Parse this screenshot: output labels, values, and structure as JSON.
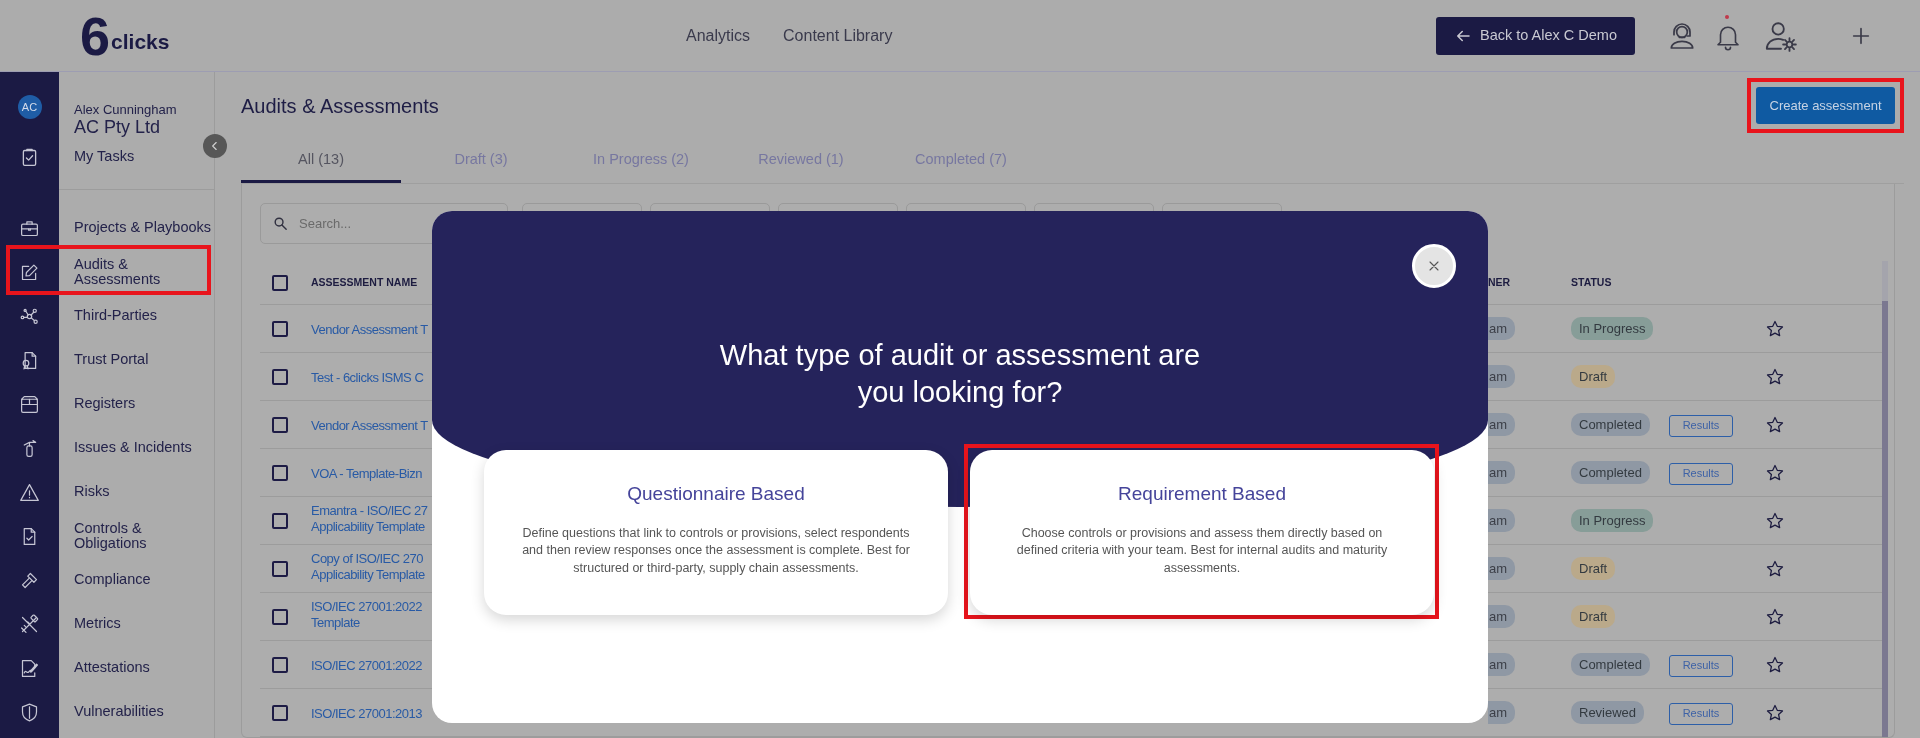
{
  "topbar": {
    "logo_mark": "6",
    "logo_text": "clicks",
    "nav": [
      "Analytics",
      "Content Library"
    ],
    "back_button": "Back to Alex C Demo",
    "notification_dot": true
  },
  "user": {
    "initials": "AC",
    "name": "Alex Cunningham",
    "company": "AC Pty Ltd"
  },
  "sidebar": {
    "my_tasks": "My Tasks",
    "items": [
      {
        "label": "Projects & Playbooks",
        "kind": "briefcase",
        "highlighted": false
      },
      {
        "label": "Audits &\nAssessments",
        "kind": "edit",
        "highlighted": true
      },
      {
        "label": "Third-Parties",
        "kind": "network",
        "highlighted": false
      },
      {
        "label": "Trust Portal",
        "kind": "certificate",
        "highlighted": false
      },
      {
        "label": "Registers",
        "kind": "box",
        "highlighted": false
      },
      {
        "label": "Issues & Incidents",
        "kind": "extinguisher",
        "highlighted": false
      },
      {
        "label": "Risks",
        "kind": "warning",
        "highlighted": false
      },
      {
        "label": "Controls &\nObligations",
        "kind": "doccheck",
        "highlighted": false
      },
      {
        "label": "Compliance",
        "kind": "hammer",
        "highlighted": false
      },
      {
        "label": "Metrics",
        "kind": "tools",
        "highlighted": false
      },
      {
        "label": "Attestations",
        "kind": "signature",
        "highlighted": false
      },
      {
        "label": "Vulnerabilities",
        "kind": "shield",
        "highlighted": false
      }
    ]
  },
  "page": {
    "title": "Audits & Assessments",
    "create_button": {
      "label": "Create assessment",
      "highlighted": true
    }
  },
  "tabs": [
    {
      "label": "All (13)",
      "selected": true
    },
    {
      "label": "Draft (3)",
      "selected": false
    },
    {
      "label": "In Progress (2)",
      "selected": false
    },
    {
      "label": "Reviewed (1)",
      "selected": false
    },
    {
      "label": "Completed (7)",
      "selected": false
    }
  ],
  "search": {
    "placeholder": "Search..."
  },
  "filters": [
    {
      "kind": "dropdown"
    },
    {
      "kind": "dropdown"
    },
    {
      "kind": "dropdown"
    },
    {
      "kind": "dropdown"
    },
    {
      "kind": "dropdown"
    },
    {
      "kind": "dropdown"
    }
  ],
  "table": {
    "select_all_checked": false,
    "columns": [
      "ASSESSMENT NAME",
      "NER",
      "STATUS"
    ],
    "rows": [
      {
        "checked": false,
        "name": "Vendor Assessment T",
        "owner": "am",
        "status": "In Progress",
        "color": "#879d98",
        "starred": false
      },
      {
        "checked": false,
        "name": "Test - 6clicks ISMS C",
        "owner": "am",
        "status": "Draft",
        "color": "#baa98a",
        "starred": false
      },
      {
        "checked": false,
        "name": "Vendor Assessment T",
        "owner": "am",
        "status": "Completed",
        "color": "#8f98a4",
        "results": "Results",
        "starred": false
      },
      {
        "checked": false,
        "name": "VOA - Template-Bizn",
        "owner": "am",
        "status": "Completed",
        "color": "#8f98a4",
        "results": "Results",
        "starred": false
      },
      {
        "checked": false,
        "name": "Emantra - ISO/IEC 27\nApplicability Template",
        "owner": "am",
        "status": "In Progress",
        "color": "#879d98",
        "starred": false
      },
      {
        "checked": false,
        "name": "Copy of ISO/IEC 270\nApplicability Template",
        "owner": "am",
        "status": "Draft",
        "color": "#baa98a",
        "starred": false
      },
      {
        "checked": false,
        "name": "ISO/IEC 27001:2022\nTemplate",
        "owner": "am",
        "status": "Draft",
        "color": "#baa98a",
        "starred": false
      },
      {
        "checked": false,
        "name": "ISO/IEC 27001:2022",
        "owner": "am",
        "status": "Completed",
        "color": "#8f98a4",
        "results": "Results",
        "starred": false
      },
      {
        "checked": false,
        "name": "ISO/IEC 27001:2013",
        "owner": "am",
        "status": "Reviewed",
        "color": "#8f98a4",
        "results": "Results",
        "starred": false
      }
    ]
  },
  "modal": {
    "title": "What type of audit or assessment are\nyou looking for?",
    "options": [
      {
        "title": "Questionnaire Based",
        "description": "Define questions that link to controls or provisions, select respondents and then review responses once the assessment is complete. Best for structured or third-party, supply chain assessments.",
        "highlighted": false
      },
      {
        "title": "Requirement Based",
        "description": "Choose controls or provisions and assess them directly based on defined criteria with your team. Best for internal audits and maturity assessments.",
        "highlighted": true
      }
    ]
  }
}
